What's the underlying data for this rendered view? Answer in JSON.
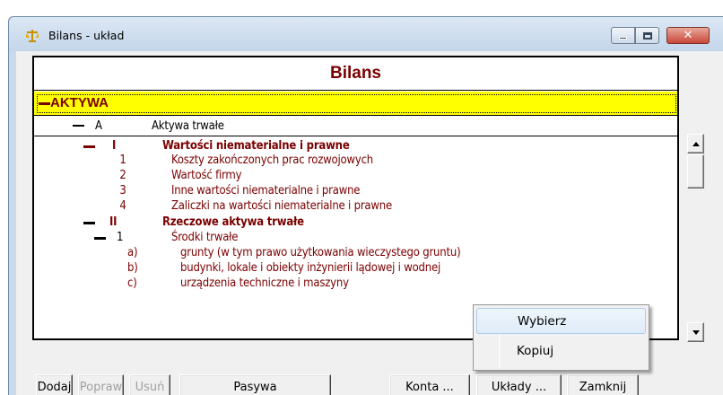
{
  "window": {
    "title": "Bilans - układ",
    "icon": "balance-scale-icon",
    "close_glyph": "✕"
  },
  "panel": {
    "title": "Bilans"
  },
  "tree": {
    "aktywa": "AKTYWA",
    "a_code": "A",
    "a_label": "Aktywa trwałe",
    "i_code": "I",
    "i_label": "Wartości niematerialne i prawne",
    "i_items": [
      {
        "code": "1",
        "label": "Koszty zakończonych prac rozwojowych"
      },
      {
        "code": "2",
        "label": "Wartość firmy"
      },
      {
        "code": "3",
        "label": "Inne wartości niematerialne i prawne"
      },
      {
        "code": "4",
        "label": "Zaliczki na wartości niematerialne i prawne"
      }
    ],
    "ii_code": "II",
    "ii_label": "Rzeczowe aktywa trwałe",
    "ii1_code": "1",
    "ii1_label": "Środki trwałe",
    "ii1_items": [
      {
        "code": "a)",
        "label": "grunty (w tym prawo użytkowania wieczystego gruntu)"
      },
      {
        "code": "b)",
        "label": "budynki, lokale i obiekty inżynierii lądowej i wodnej"
      },
      {
        "code": "c)",
        "label": "urządzenia techniczne i maszyny"
      }
    ]
  },
  "buttons": {
    "dodaj": "Dodaj",
    "popraw": "Popraw",
    "usun": "Usuń",
    "pasywa": "Pasywa",
    "konta": "Konta ...",
    "uklady": "Układy ...",
    "zamknij": "Zamknij"
  },
  "menu": {
    "items": [
      "Wybierz",
      "Kopiuj"
    ]
  },
  "colors": {
    "accent_dark_red": "#7a0000",
    "highlight_yellow": "#ffff00"
  }
}
